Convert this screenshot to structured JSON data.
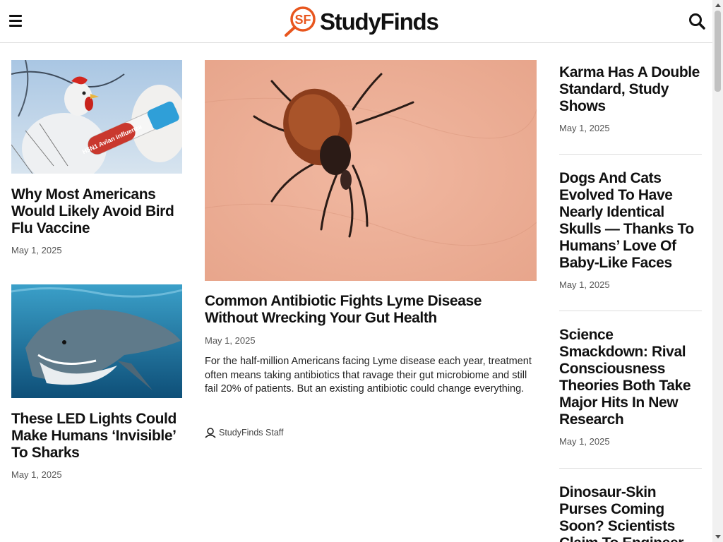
{
  "header": {
    "logo_text": "StudyFinds",
    "logo_mark_text": "SF",
    "menu_icon": "hamburger-menu-icon",
    "search_icon": "search-icon",
    "accent_color": "#e8561e"
  },
  "left_column": [
    {
      "title": "Why Most Americans Would Likely Avoid Bird Flu Vaccine",
      "date": "May 1, 2025",
      "image_label": "H5N1 Avian influenza"
    },
    {
      "title": "These LED Lights Could Make Humans ‘Invisible’ To Sharks",
      "date": "May 1, 2025"
    }
  ],
  "featured": {
    "title": "Common Antibiotic Fights Lyme Disease Without Wrecking Your Gut Health",
    "date": "May 1, 2025",
    "excerpt": "For the half-million Americans facing Lyme disease each year, treatment often means taking antibiotics that ravage their gut microbiome and still fail 20% of patients. But an existing antibiotic could change everything.",
    "author": "StudyFinds Staff"
  },
  "right_column": [
    {
      "title": "Karma Has A Double Standard, Study Shows",
      "date": "May 1, 2025"
    },
    {
      "title": "Dogs And Cats Evolved To Have Nearly Identical Skulls — Thanks To Humans’ Love Of Baby-Like Faces",
      "date": "May 1, 2025"
    },
    {
      "title": "Science Smackdown: Rival Consciousness Theories Both Take Major Hits In New Research",
      "date": "May 1, 2025"
    },
    {
      "title": "Dinosaur-Skin Purses Coming Soon? Scientists Claim To Engineer Leather",
      "date": ""
    }
  ]
}
